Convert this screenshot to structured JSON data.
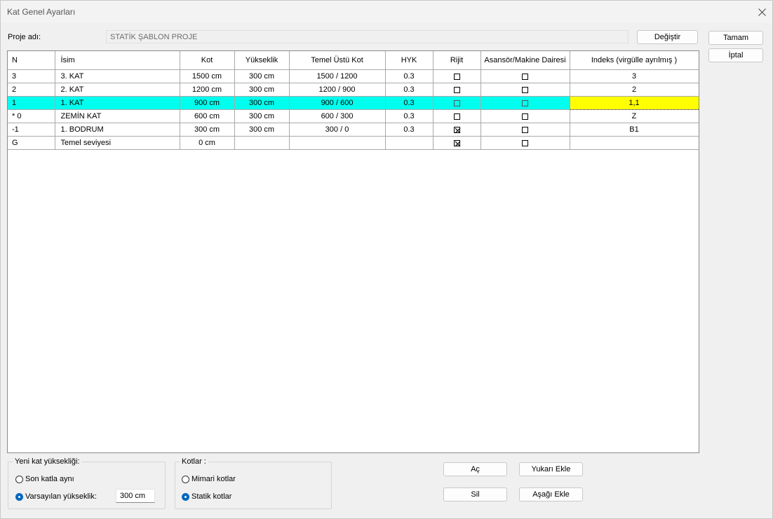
{
  "window": {
    "title": "Kat Genel Ayarları"
  },
  "project": {
    "label": "Proje adı:",
    "value": "STATİK ŞABLON PROJE",
    "change_button": "Değiştir"
  },
  "dialog_buttons": {
    "ok": "Tamam",
    "cancel": "İptal"
  },
  "table": {
    "columns": [
      "N",
      "İsim",
      "Kot",
      "Yükseklik",
      "Temel Üstü Kot",
      "HYK",
      "Rijit",
      "Asansör/Makine Dairesi",
      "Indeks (virgülle ayrılmış )"
    ],
    "rows": [
      {
        "n": "3",
        "name": "3. KAT",
        "kot": "1500 cm",
        "height": "300 cm",
        "foundation": "1500 / 1200",
        "hyk": "0.3",
        "rigid": false,
        "elevator": false,
        "index": "3",
        "selected": false
      },
      {
        "n": "2",
        "name": "2. KAT",
        "kot": "1200 cm",
        "height": "300 cm",
        "foundation": "1200 / 900",
        "hyk": "0.3",
        "rigid": false,
        "elevator": false,
        "index": "2",
        "selected": false
      },
      {
        "n": "1",
        "name": "1. KAT",
        "kot": "900 cm",
        "height": "300 cm",
        "foundation": "900 / 600",
        "hyk": "0.3",
        "rigid": false,
        "elevator": false,
        "index": "1,1",
        "selected": true
      },
      {
        "n": "* 0",
        "name": "ZEMİN KAT",
        "kot": "600 cm",
        "height": "300 cm",
        "foundation": "600 / 300",
        "hyk": "0.3",
        "rigid": false,
        "elevator": false,
        "index": "Z",
        "selected": false
      },
      {
        "n": "-1",
        "name": "1. BODRUM",
        "kot": "300 cm",
        "height": "300 cm",
        "foundation": "300 / 0",
        "hyk": "0.3",
        "rigid": true,
        "elevator": false,
        "index": "B1",
        "selected": false
      },
      {
        "n": "G",
        "name": "Temel seviyesi",
        "kot": "0 cm",
        "height": "",
        "foundation": "",
        "hyk": "",
        "rigid": true,
        "elevator": false,
        "index": "",
        "selected": false
      }
    ]
  },
  "new_floor_height": {
    "title": "Yeni kat yüksekliği:",
    "option_same": "Son katla aynı",
    "option_default": "Varsayılan yükseklik:",
    "selected": "default",
    "default_value": "300 cm"
  },
  "elevations": {
    "title": "Kotlar :",
    "option_arch": "Mimari kotlar",
    "option_struct": "Statik kotlar",
    "selected": "struct"
  },
  "actions": {
    "open": "Aç",
    "delete": "Sil",
    "add_above": "Yukarı Ekle",
    "add_below": "Aşağı Ekle"
  },
  "colors": {
    "selected_row": "#00ffee",
    "selected_cell": "#ffff00",
    "radio_accent": "#0067c0"
  },
  "icons": {
    "close": "close-icon",
    "checkbox": "checkbox-icon"
  }
}
